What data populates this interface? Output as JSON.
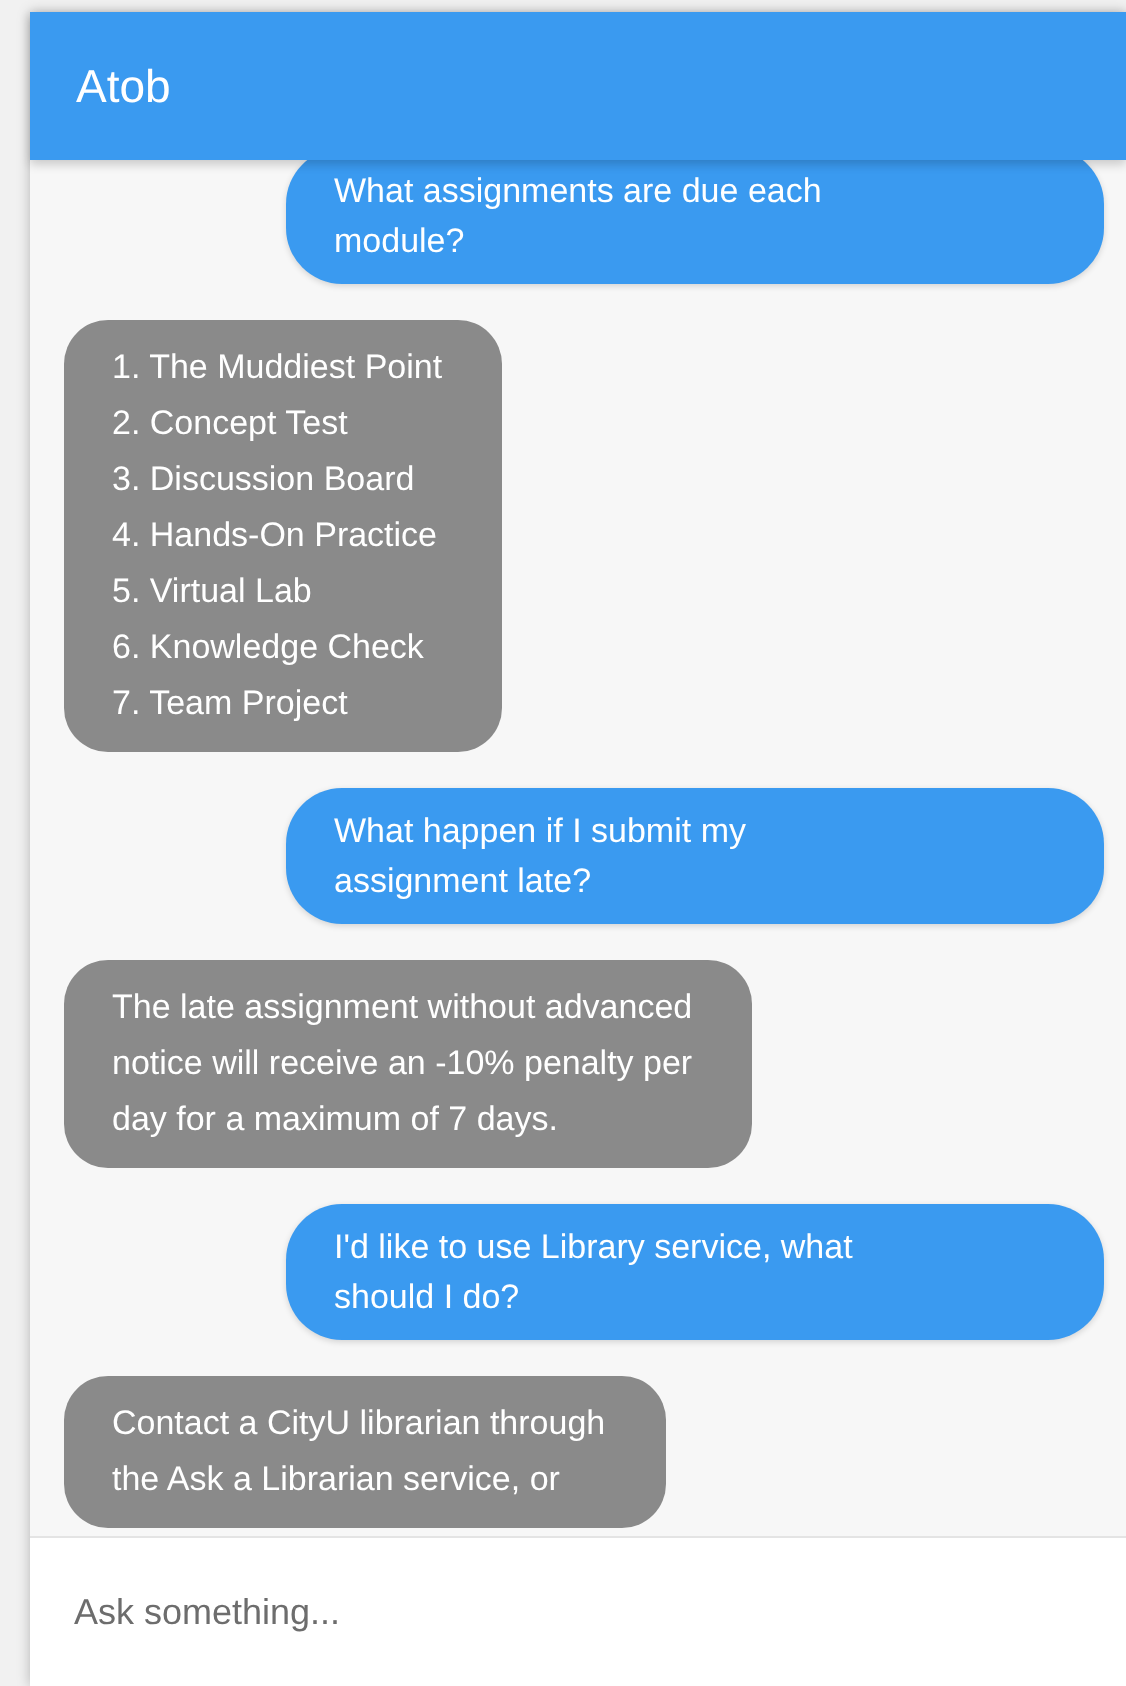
{
  "header": {
    "title": "Atob"
  },
  "messages": [
    {
      "kind": "user",
      "lines": [
        "What assignments are due each",
        "module?"
      ]
    },
    {
      "kind": "bot",
      "items": [
        "1. The Muddiest Point",
        "2. Concept Test",
        "3. Discussion Board",
        "4. Hands-On Practice",
        "5. Virtual Lab",
        "6. Knowledge Check",
        "7. Team Project"
      ]
    },
    {
      "kind": "user",
      "lines": [
        "What happen if I submit my",
        "assignment late?"
      ]
    },
    {
      "kind": "bot",
      "lines": [
        "The late assignment without advanced",
        "notice will receive an -10% penalty per",
        "day for a maximum of 7 days."
      ]
    },
    {
      "kind": "user",
      "lines": [
        "I'd like to use Library service, what",
        "should I do?"
      ]
    },
    {
      "kind": "bot",
      "lines": [
        "Contact a CityU librarian through",
        "the Ask a Librarian service, or"
      ]
    }
  ],
  "input": {
    "placeholder": "Ask something..."
  }
}
